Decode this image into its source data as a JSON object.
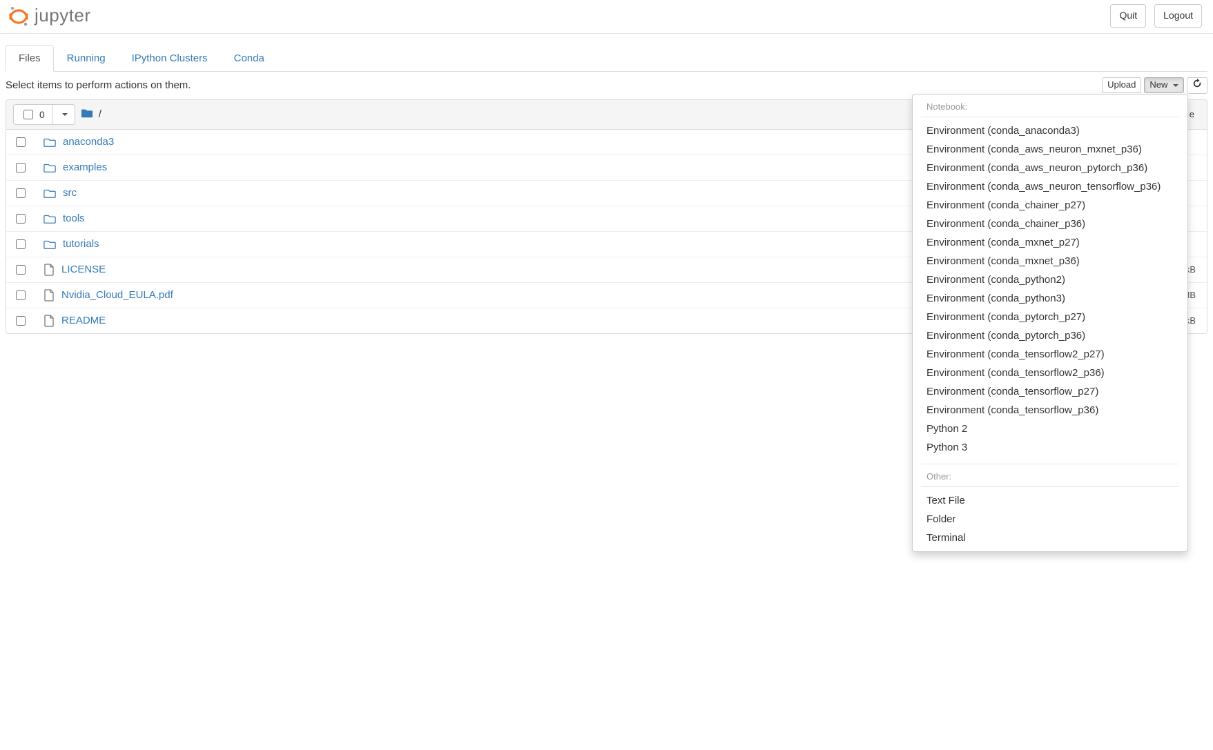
{
  "header": {
    "logo_text": "jupyter",
    "quit_label": "Quit",
    "logout_label": "Logout"
  },
  "tabs": [
    {
      "label": "Files",
      "active": true
    },
    {
      "label": "Running",
      "active": false
    },
    {
      "label": "IPython Clusters",
      "active": false
    },
    {
      "label": "Conda",
      "active": false
    }
  ],
  "hint_text": "Select items to perform actions on them.",
  "toolbar": {
    "upload_label": "Upload",
    "new_label": "New",
    "selected_count": "0"
  },
  "breadcrumb_slash": "/",
  "columns": {
    "size_label": "e"
  },
  "files": [
    {
      "name": "anaconda3",
      "type": "folder",
      "size": ""
    },
    {
      "name": "examples",
      "type": "folder",
      "size": ""
    },
    {
      "name": "src",
      "type": "folder",
      "size": ""
    },
    {
      "name": "tools",
      "type": "folder",
      "size": ""
    },
    {
      "name": "tutorials",
      "type": "folder",
      "size": ""
    },
    {
      "name": "LICENSE",
      "type": "file",
      "size": "kB"
    },
    {
      "name": "Nvidia_Cloud_EULA.pdf",
      "type": "file",
      "size": "MB"
    },
    {
      "name": "README",
      "type": "file",
      "size": "kB"
    }
  ],
  "new_menu": {
    "notebook_header": "Notebook:",
    "notebook_items": [
      "Environment (conda_anaconda3)",
      "Environment (conda_aws_neuron_mxnet_p36)",
      "Environment (conda_aws_neuron_pytorch_p36)",
      "Environment (conda_aws_neuron_tensorflow_p36)",
      "Environment (conda_chainer_p27)",
      "Environment (conda_chainer_p36)",
      "Environment (conda_mxnet_p27)",
      "Environment (conda_mxnet_p36)",
      "Environment (conda_python2)",
      "Environment (conda_python3)",
      "Environment (conda_pytorch_p27)",
      "Environment (conda_pytorch_p36)",
      "Environment (conda_tensorflow2_p27)",
      "Environment (conda_tensorflow2_p36)",
      "Environment (conda_tensorflow_p27)",
      "Environment (conda_tensorflow_p36)",
      "Python 2",
      "Python 3"
    ],
    "other_header": "Other:",
    "other_items": [
      "Text File",
      "Folder",
      "Terminal"
    ]
  }
}
